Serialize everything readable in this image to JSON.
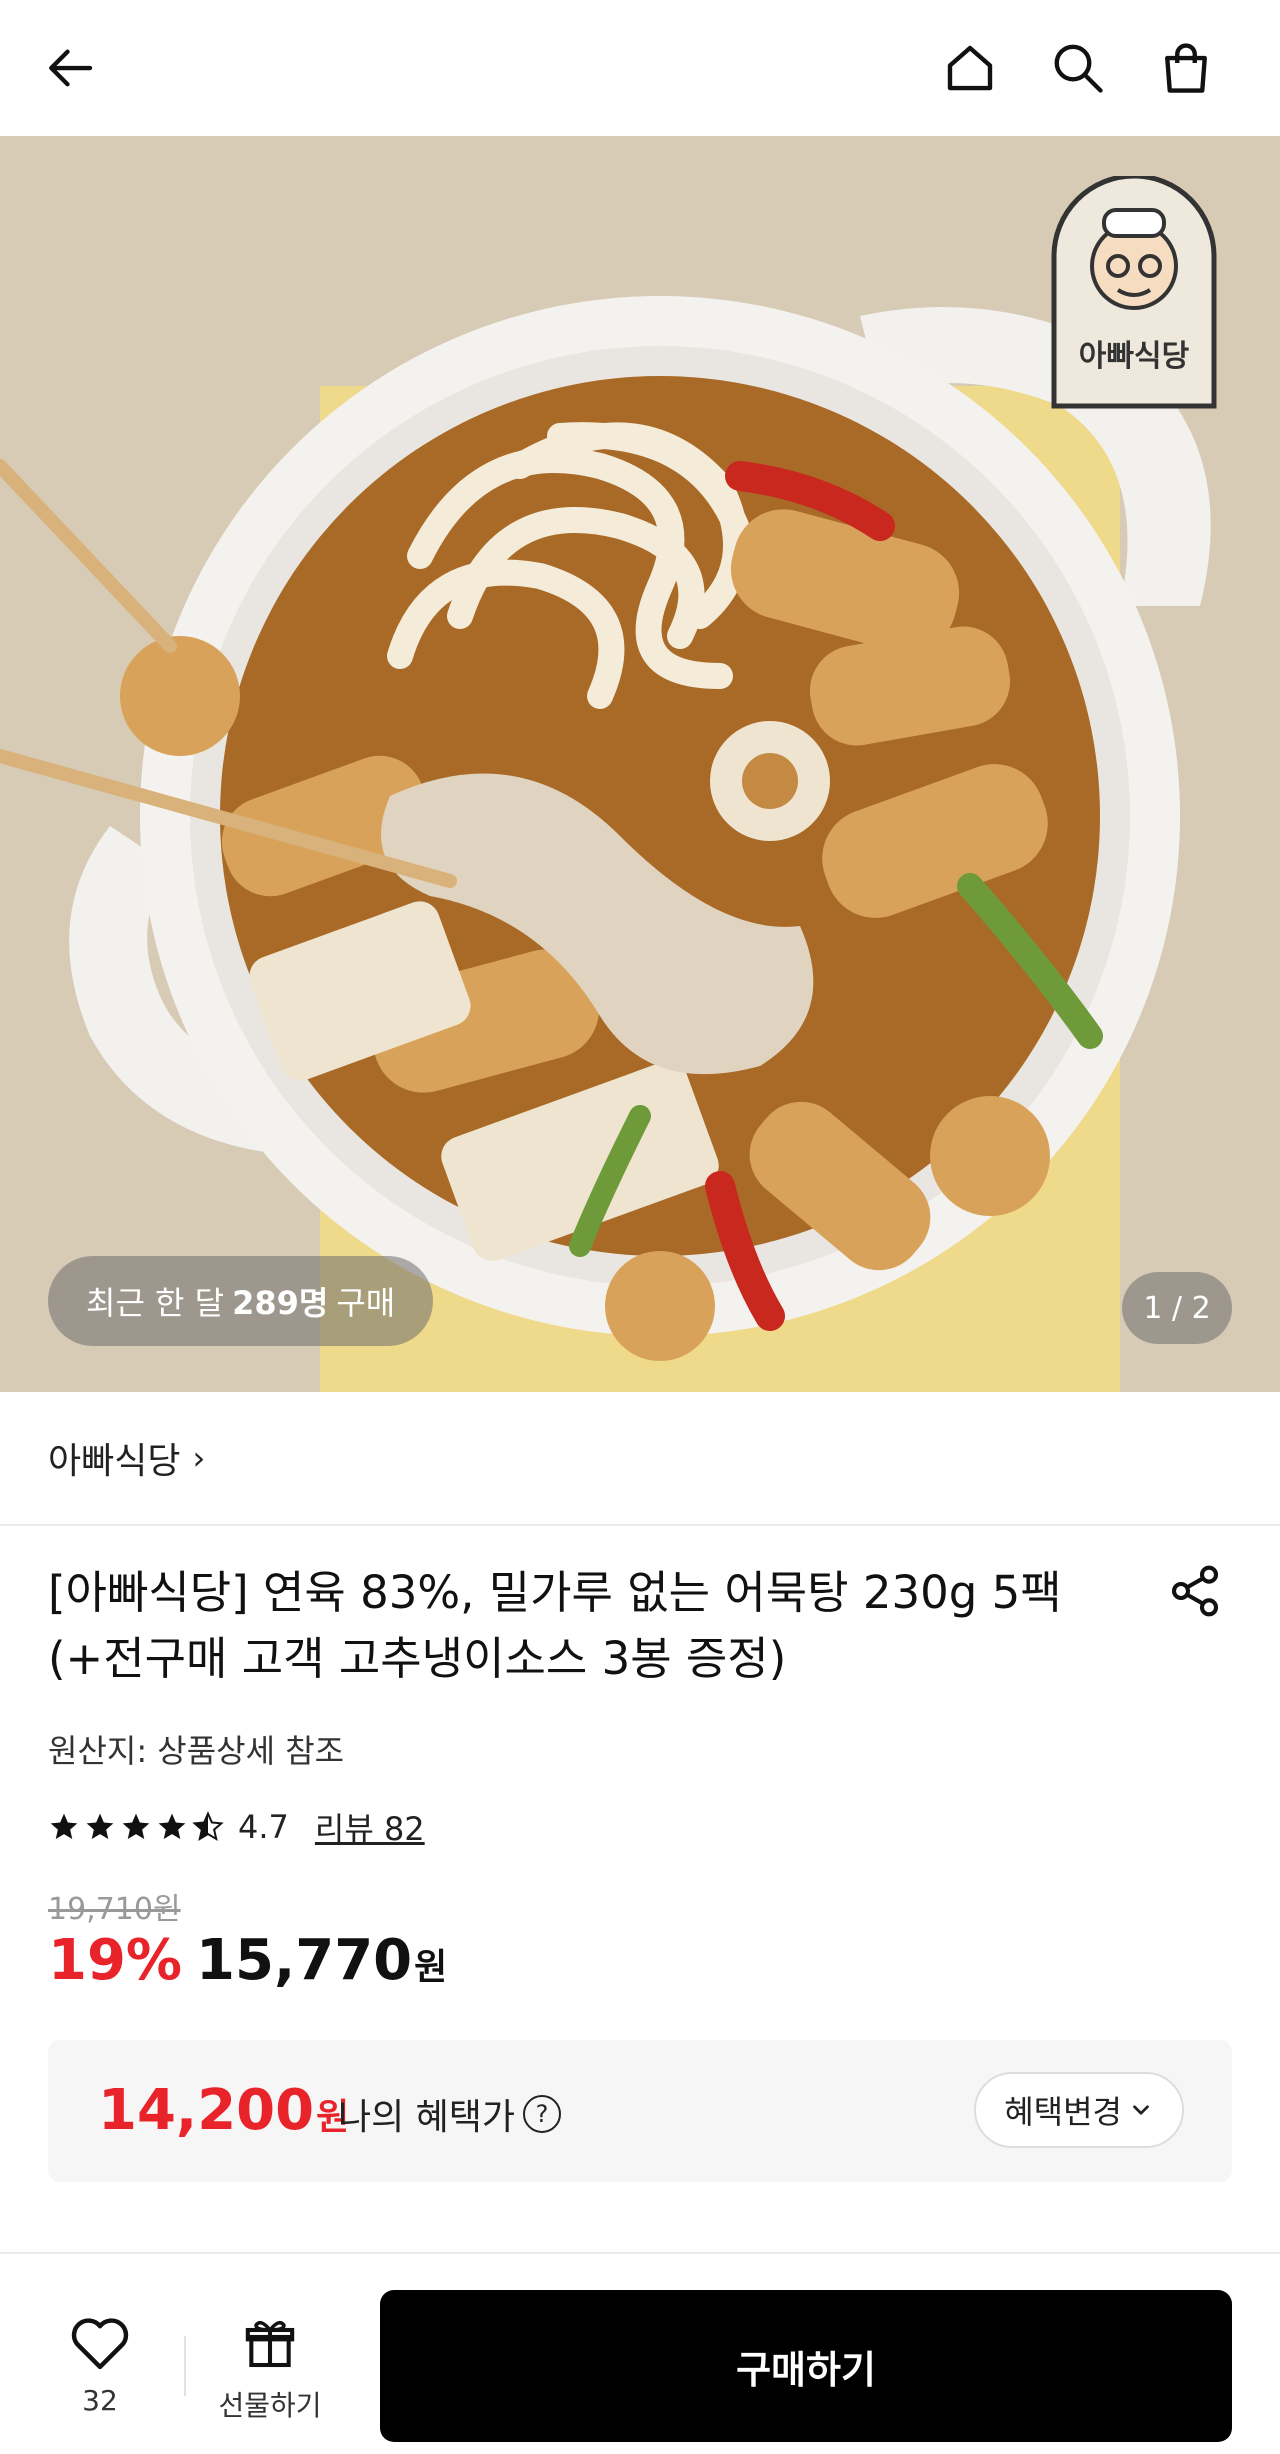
{
  "header": {
    "back_icon": "arrow-left-icon",
    "home_icon": "home-icon",
    "search_icon": "search-icon",
    "cart_icon": "shopping-bag-icon"
  },
  "hero": {
    "purchase_prefix": "최근 한 달",
    "purchase_count": "289명",
    "purchase_suffix": "구매",
    "page_counter": "1 / 2",
    "logo_text": "아빠식당"
  },
  "brand": {
    "name": "아빠식당",
    "chevron": "›"
  },
  "product": {
    "title": "[아빠식당] 연육 83%, 밀가루 없는 어묵탕 230g 5팩 (+전구매 고객 고추냉이소스 3봉 증정)",
    "origin": "원산지: 상품상세 참조",
    "rating": "4.7",
    "rating_stars": 4.5,
    "review_label": "리뷰 82",
    "original_price": "19,710원",
    "discount": "19%",
    "price": "15,770",
    "won": "원"
  },
  "benefit": {
    "price": "14,200",
    "won": "원",
    "label": "나의 혜택가",
    "help": "?",
    "change_label": "혜택변경"
  },
  "bottom": {
    "wish_count": "32",
    "gift_label": "선물하기",
    "buy_label": "구매하기"
  },
  "colors": {
    "accent_red": "#e8232a",
    "buy_button": "#000000"
  }
}
